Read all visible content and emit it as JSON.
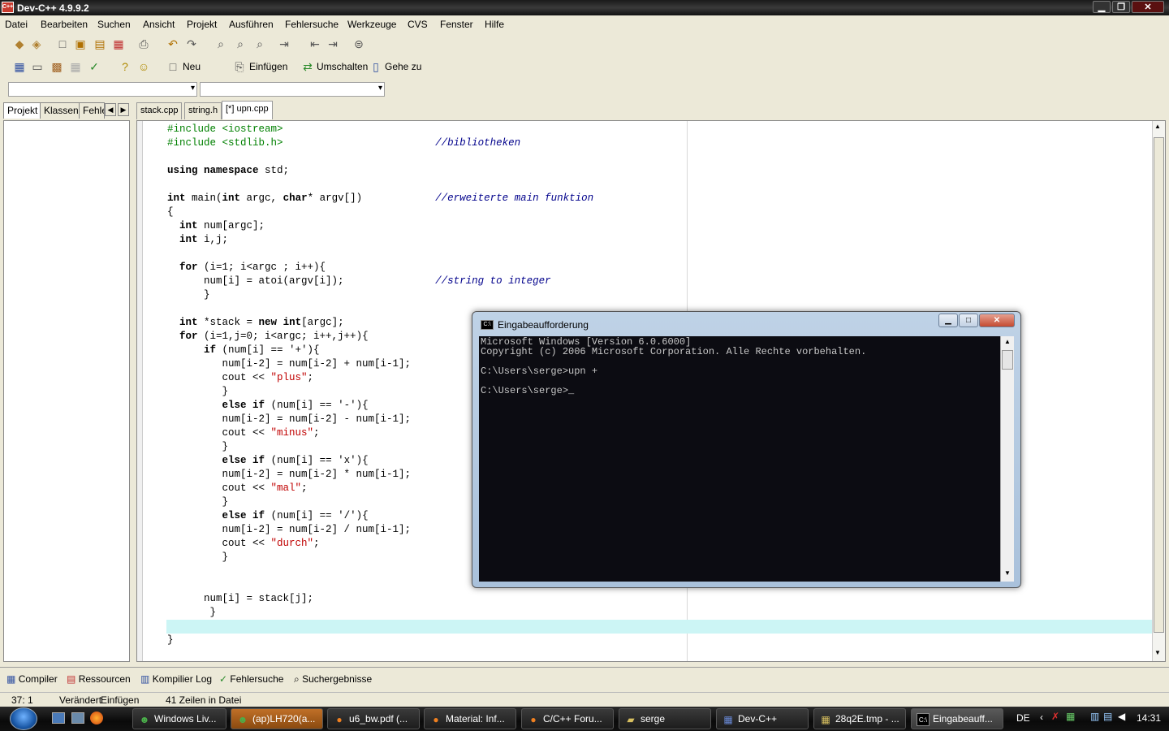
{
  "window": {
    "title": "Dev-C++ 4.9.9.2"
  },
  "menu": [
    "Datei",
    "Bearbeiten",
    "Suchen",
    "Ansicht",
    "Projekt",
    "Ausführen",
    "Fehlersuche",
    "Werkzeuge",
    "CVS",
    "Fenster",
    "Hilfe"
  ],
  "toolbar": {
    "new_label": "Neu",
    "insert_label": "Einfügen",
    "toggle_label": "Umschalten",
    "goto_label": "Gehe zu"
  },
  "left_tabs": [
    "Projekt",
    "Klassen",
    "Fehle"
  ],
  "file_tabs": [
    "stack.cpp",
    "string.h",
    "[*] upn.cpp"
  ],
  "code_lines": [
    "#include <iostream>",
    "#include <stdlib.h>                         //bibliotheken",
    "",
    "using namespace std;",
    "",
    "int main(int argc, char* argv[])            //erweiterte main funktion",
    "{",
    "  int num[argc];",
    "  int i,j;",
    "",
    "  for (i=1; i<argc ; i++){",
    "      num[i] = atoi(argv[i]);               //string to integer",
    "      }",
    "",
    "  int *stack = new int[argc];",
    "  for (i=1,j=0; i<argc; i++,j++){",
    "      if (num[i] == '+'){",
    "         num[i-2] = num[i-2] + num[i-1];",
    "         cout << \"plus\";",
    "         }",
    "         else if (num[i] == '-'){",
    "         num[i-2] = num[i-2] - num[i-1];",
    "         cout << \"minus\";",
    "         }",
    "         else if (num[i] == 'x'){",
    "         num[i-2] = num[i-2] * num[i-1];",
    "         cout << \"mal\";",
    "         }",
    "         else if (num[i] == '/'){",
    "         num[i-2] = num[i-2] / num[i-1];",
    "         cout << \"durch\";",
    "         }",
    "",
    "",
    "      num[i] = stack[j];",
    "       }",
    "",
    "}"
  ],
  "cmd": {
    "title": "Eingabeaufforderung",
    "lines": [
      "Microsoft Windows [Version 6.0.6000]",
      "Copyright (c) 2006 Microsoft Corporation. Alle Rechte vorbehalten.",
      "",
      "C:\\Users\\serge>upn +",
      "",
      "C:\\Users\\serge>_"
    ]
  },
  "bottom_tabs": [
    "Compiler",
    "Ressourcen",
    "Kompilier Log",
    "Fehlersuche",
    "Suchergebnisse"
  ],
  "status": {
    "position": "37: 1",
    "modified": "Verändert",
    "mode": "Einfügen",
    "lines": "41 Zeilen in Datei"
  },
  "taskbar": {
    "items": [
      "Windows Liv...",
      "(ap)LH720(a...",
      "u6_bw.pdf (...",
      "Material: Inf...",
      "C/C++ Foru...",
      "serge",
      "Dev-C++",
      "28q2E.tmp - ...",
      "Eingabeauff..."
    ],
    "lang": "DE",
    "clock": "14:31"
  }
}
